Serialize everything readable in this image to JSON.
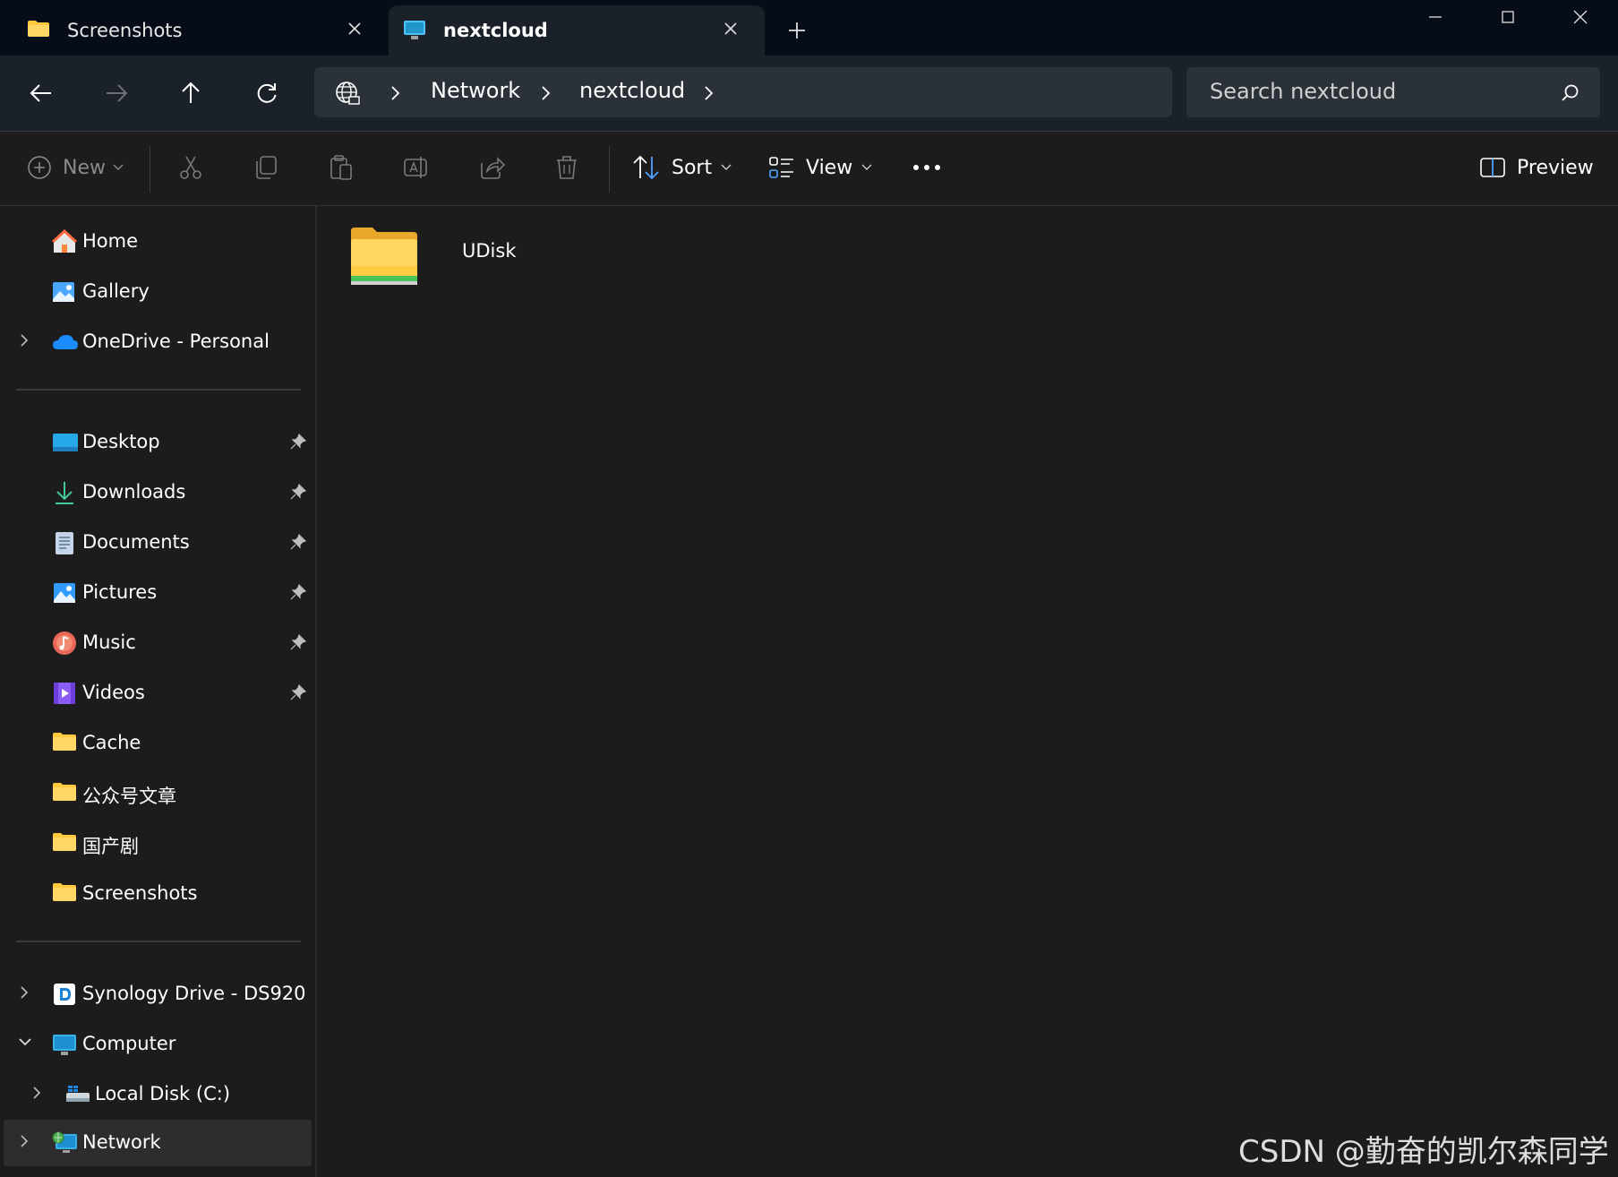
{
  "tabs": [
    {
      "label": "Screenshots",
      "icon": "folder-icon",
      "active": false
    },
    {
      "label": "nextcloud",
      "icon": "monitor-icon",
      "active": true
    }
  ],
  "window_controls": {
    "minimize": "minimize-icon",
    "maximize": "maximize-icon",
    "close": "close-icon"
  },
  "address": {
    "root_icon": "globe-icon",
    "segments": [
      "Network",
      "nextcloud"
    ]
  },
  "search": {
    "placeholder": "Search nextcloud"
  },
  "toolbar": {
    "new_label": "New",
    "sort_label": "Sort",
    "view_label": "View",
    "preview_label": "Preview",
    "icons": [
      "cut-icon",
      "copy-icon",
      "paste-icon",
      "rename-icon",
      "share-icon",
      "delete-icon",
      "more-icon"
    ]
  },
  "sidebar": {
    "quick": [
      {
        "label": "Home",
        "icon": "home-icon"
      },
      {
        "label": "Gallery",
        "icon": "gallery-icon"
      },
      {
        "label": "OneDrive - Personal",
        "icon": "cloud-icon",
        "expandable": true
      }
    ],
    "pinned": [
      {
        "label": "Desktop",
        "icon": "desktop-icon",
        "pinned": true
      },
      {
        "label": "Downloads",
        "icon": "download-icon",
        "pinned": true
      },
      {
        "label": "Documents",
        "icon": "document-icon",
        "pinned": true
      },
      {
        "label": "Pictures",
        "icon": "picture-icon",
        "pinned": true
      },
      {
        "label": "Music",
        "icon": "music-icon",
        "pinned": true
      },
      {
        "label": "Videos",
        "icon": "video-icon",
        "pinned": true
      },
      {
        "label": "Cache",
        "icon": "folder-icon"
      },
      {
        "label": "公众号文章",
        "icon": "folder-icon"
      },
      {
        "label": "国产剧",
        "icon": "folder-icon"
      },
      {
        "label": "Screenshots",
        "icon": "folder-icon"
      }
    ],
    "drives": [
      {
        "label": "Synology Drive - DS920",
        "icon": "synology-icon",
        "expandable": true
      },
      {
        "label": "Computer",
        "icon": "computer-icon",
        "expanded": true
      },
      {
        "label": "Local Disk (C:)",
        "icon": "drive-icon",
        "expandable": true
      },
      {
        "label": "Network",
        "icon": "network-icon",
        "expandable": true,
        "selected": true
      }
    ]
  },
  "content": {
    "items": [
      {
        "name": "UDisk",
        "type": "folder"
      }
    ]
  },
  "watermark": "CSDN @勤奋的凯尔森同学",
  "colors": {
    "titlebar": "#070d18",
    "navbar": "#1b2129",
    "background": "#1c1c1c",
    "folder": "#ffc83d",
    "selected": "#2d2d2d"
  }
}
